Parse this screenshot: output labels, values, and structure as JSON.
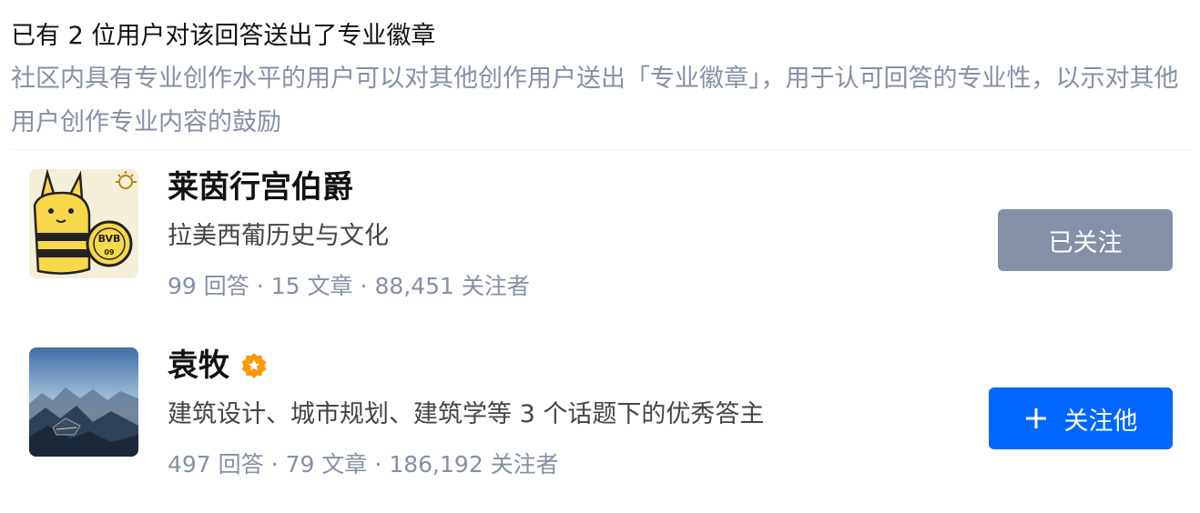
{
  "header": {
    "title": "已有 2 位用户对该回答送出了专业徽章",
    "description": "社区内具有专业创作水平的用户可以对其他创作用户送出「专业徽章」，用于认可回答的专业性，以示对其他用户创作专业内容的鼓励"
  },
  "users": [
    {
      "name": "莱茵行宫伯爵",
      "headline": "拉美西葡历史与文化",
      "answers": "99 回答",
      "articles": "15 文章",
      "followers": "88,451 关注者",
      "button_label": "已关注",
      "avatar_icon": "bee-cartoon-avatar",
      "has_badge": false
    },
    {
      "name": "袁牧",
      "headline": "建筑设计、城市规划、建筑学等 3 个话题下的优秀答主",
      "answers": "497 回答",
      "articles": "79 文章",
      "followers": "186,192 关注者",
      "button_label": "关注他",
      "avatar_icon": "mountain-landscape-avatar",
      "has_badge": true
    }
  ],
  "stats_separator": "·",
  "colors": {
    "muted_text": "#8590a6",
    "followed_button": "#8590a6",
    "follow_button": "#0066ff",
    "badge": "#ff9607"
  }
}
